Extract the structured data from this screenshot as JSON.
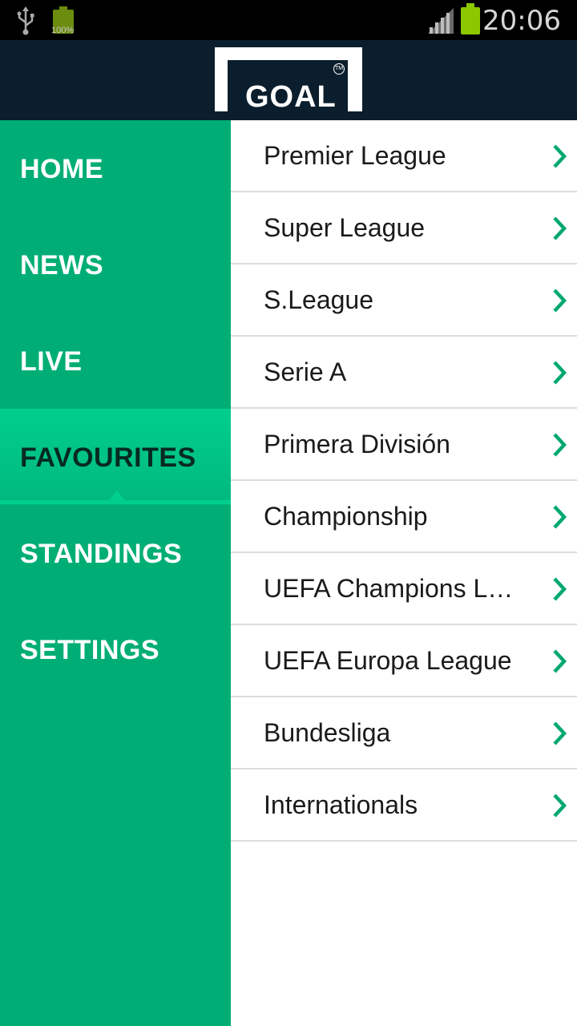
{
  "status_bar": {
    "battery_small_label": "100%",
    "time": "20:06",
    "icons": [
      "usb-icon",
      "battery-icon",
      "signal-icon",
      "battery-full-icon"
    ]
  },
  "header": {
    "logo_text": "GOAL",
    "logo_trademark": "TM"
  },
  "drawer": {
    "items": [
      {
        "label": "HOME",
        "active": false
      },
      {
        "label": "NEWS",
        "active": false
      },
      {
        "label": "LIVE",
        "active": false
      },
      {
        "label": "FAVOURITES",
        "active": true
      },
      {
        "label": "STANDINGS",
        "active": false
      },
      {
        "label": "SETTINGS",
        "active": false
      }
    ]
  },
  "leagues": [
    {
      "name": "Premier League"
    },
    {
      "name": "Super League"
    },
    {
      "name": "S.League"
    },
    {
      "name": "Serie A"
    },
    {
      "name": "Primera División"
    },
    {
      "name": "Championship"
    },
    {
      "name": "UEFA Champions L…"
    },
    {
      "name": "UEFA Europa League"
    },
    {
      "name": "Bundesliga"
    },
    {
      "name": "Internationals"
    }
  ],
  "colors": {
    "accent": "#00AE75",
    "active": "#00CE8C",
    "header_bg": "#0B1E2D",
    "chevron": "#00A870"
  }
}
